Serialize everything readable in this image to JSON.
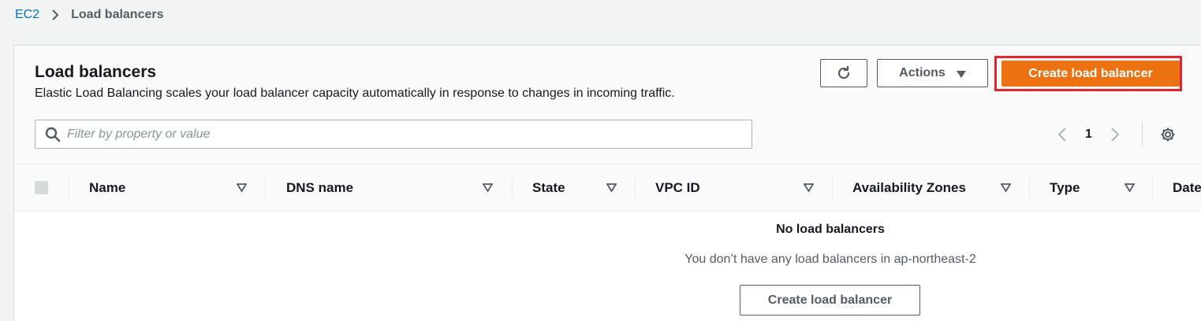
{
  "breadcrumb": {
    "parent": "EC2",
    "current": "Load balancers"
  },
  "header": {
    "title": "Load balancers",
    "description": "Elastic Load Balancing scales your load balancer capacity automatically in response to changes in incoming traffic.",
    "actions_label": "Actions",
    "create_label": "Create load balancer"
  },
  "filter": {
    "placeholder": "Filter by property or value"
  },
  "pagination": {
    "current_page": "1"
  },
  "table": {
    "columns": [
      "Name",
      "DNS name",
      "State",
      "VPC ID",
      "Availability Zones",
      "Type",
      "Date"
    ]
  },
  "empty_state": {
    "title": "No load balancers",
    "message": "You don’t have any load balancers in ap-northeast-2",
    "button_label": "Create load balancer"
  },
  "colors": {
    "primary_button": "#ec7211",
    "highlight_border": "#e0232e",
    "link": "#0073bb"
  },
  "icons": [
    "chevron-right-icon",
    "refresh-icon",
    "caret-down-icon",
    "search-icon",
    "chevron-left-icon",
    "settings-icon",
    "sort-icon"
  ]
}
